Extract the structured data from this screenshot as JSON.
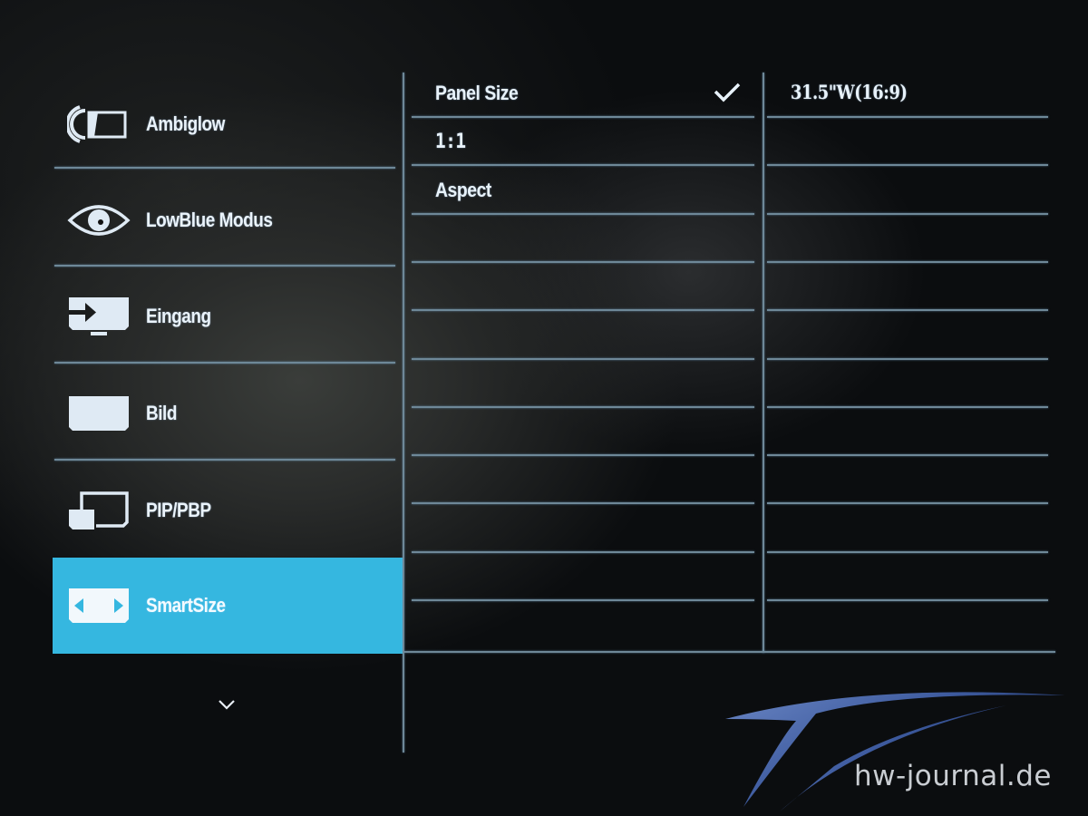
{
  "menu": {
    "items": [
      {
        "label": "Ambiglow",
        "icon": "ambiglow-icon",
        "selected": false
      },
      {
        "label": "LowBlue Modus",
        "icon": "eye-icon",
        "selected": false
      },
      {
        "label": "Eingang",
        "icon": "input-monitor-icon",
        "selected": false
      },
      {
        "label": "Bild",
        "icon": "picture-icon",
        "selected": false
      },
      {
        "label": "PIP/PBP",
        "icon": "pip-pbp-icon",
        "selected": false
      },
      {
        "label": "SmartSize",
        "icon": "smartsize-arrows-icon",
        "selected": true
      }
    ],
    "more_indicator": "chevron-down-icon"
  },
  "submenu": {
    "options": [
      {
        "label": "Panel Size",
        "checked": true
      },
      {
        "label": "1:1",
        "checked": false
      },
      {
        "label": "Aspect",
        "checked": false
      }
    ]
  },
  "value_panel": {
    "current_value": "31.5\"W(16:9)"
  },
  "colors": {
    "accent": "#35b7e0",
    "divider": "#6e8898",
    "text": "#eaf3fb"
  },
  "watermark": {
    "text": "hw-journal.de"
  }
}
